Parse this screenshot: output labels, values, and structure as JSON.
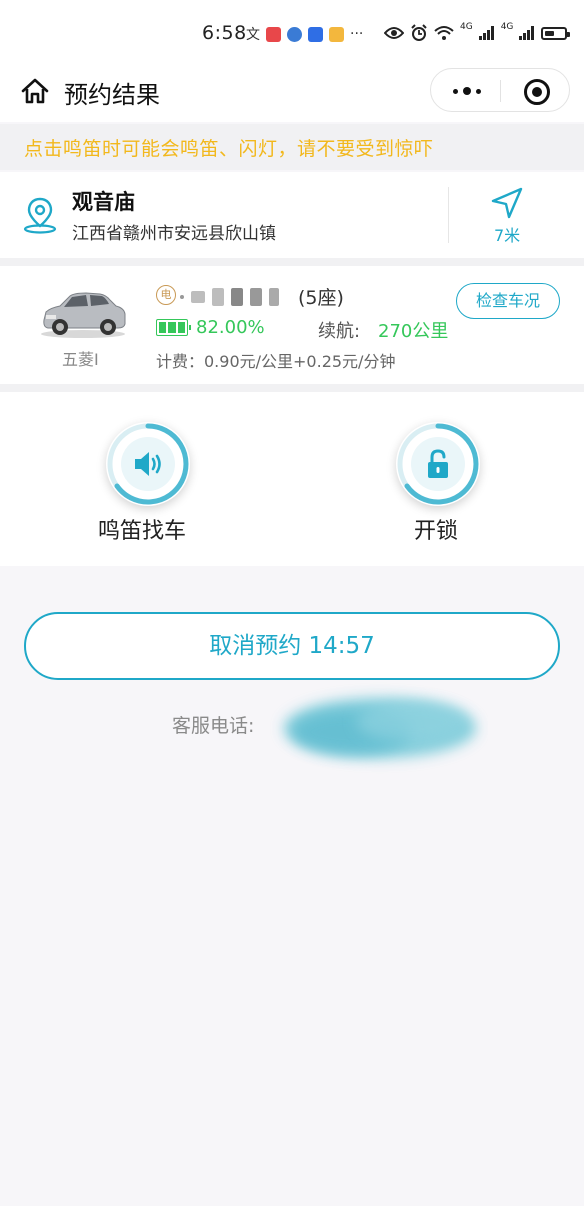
{
  "status_bar": {
    "time": "6:58",
    "more": "···",
    "network": "4G"
  },
  "nav": {
    "title": "预约结果"
  },
  "warning": "点击鸣笛时可能会鸣笛、闪灯，请不要受到惊吓",
  "location": {
    "name": "观音庙",
    "address": "江西省赣州市安远县欣山镇",
    "distance": "7米"
  },
  "car": {
    "model": "五菱I",
    "fuel_badge": "电",
    "seats": "(5座)",
    "battery_percent": "82.00%",
    "battery_level": 0.82,
    "range_label": "续航:",
    "range_value": "270公里",
    "price": "计费：0.90元/公里+0.25元/分钟",
    "check_button": "检查车况"
  },
  "actions": {
    "horn_label": "鸣笛找车",
    "unlock_label": "开锁"
  },
  "cancel_button": "取消预约 14:57",
  "service_label": "客服电话:",
  "colors": {
    "accent": "#1fa8c8",
    "warning": "#f2b81c",
    "battery": "#35c75a",
    "fuel_badge": "#c99a56"
  }
}
